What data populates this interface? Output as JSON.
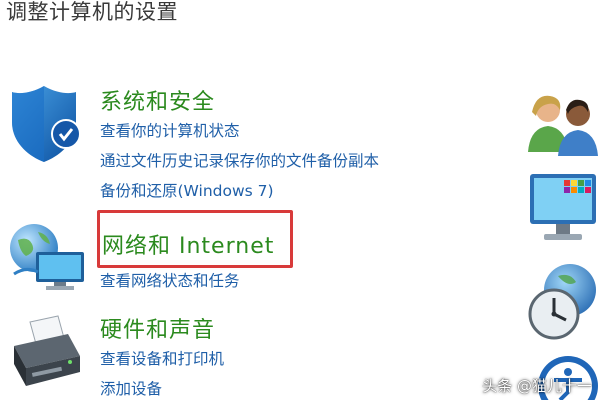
{
  "page": {
    "title": "调整计算机的设置"
  },
  "categories": [
    {
      "title": "系统和安全",
      "icon": "shield-icon",
      "links": [
        "查看你的计算机状态",
        "通过文件历史记录保存你的文件备份副本",
        "备份和还原(Windows 7)"
      ]
    },
    {
      "title": "网络和 Internet",
      "icon": "network-globe-icon",
      "links": [
        "查看网络状态和任务"
      ]
    },
    {
      "title": "硬件和声音",
      "icon": "printer-icon",
      "links": [
        "查看设备和打印机",
        "添加设备"
      ]
    }
  ],
  "right_icons": [
    "user-accounts-icon",
    "appearance-monitor-icon",
    "clock-globe-icon",
    "ease-of-access-icon"
  ],
  "watermark": "头条 @猫儿十一",
  "colors": {
    "category_title": "#2b8a1e",
    "link": "#1f5fa8",
    "highlight": "#d83a3a"
  }
}
